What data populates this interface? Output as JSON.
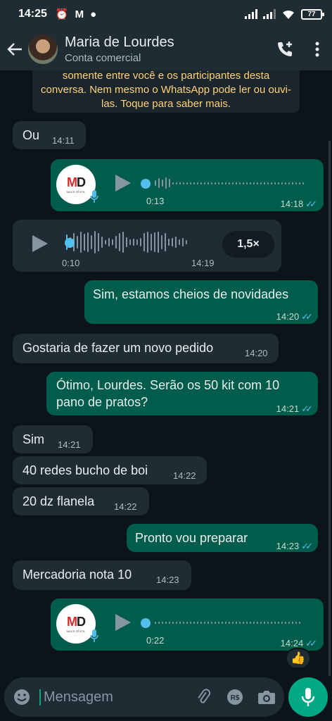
{
  "status_bar": {
    "time": "14:25",
    "battery": "77"
  },
  "header": {
    "contact_name": "Maria de Lourdes",
    "contact_subtitle": "Conta comercial"
  },
  "encryption_notice": "somente entre você e os participantes desta conversa. Nem mesmo o WhatsApp pode ler ou ouvi-las. Toque para saber mais.",
  "messages": [
    {
      "dir": "in",
      "text": "Ou",
      "time": "14:11"
    },
    {
      "dir": "out",
      "type": "audio",
      "duration": "0:13",
      "time": "14:18",
      "logo": "MD",
      "logo_sub": "MULTI TÊXTIL"
    },
    {
      "dir": "in",
      "type": "audio",
      "duration": "0:10",
      "time": "14:19",
      "speed": "1,5×"
    },
    {
      "dir": "out",
      "text": "Sim, estamos cheios de novidades",
      "time": "14:20"
    },
    {
      "dir": "in",
      "text": "Gostaria de fazer um novo pedido",
      "time": "14:20"
    },
    {
      "dir": "out",
      "text_line1": "Ótimo, Lourdes. Serão os 50 kit com 10",
      "text_line2": "pano de pratos?",
      "time": "14:21"
    },
    {
      "dir": "in",
      "text": "Sim",
      "time": "14:21"
    },
    {
      "dir": "in",
      "text": "40 redes bucho de boi",
      "time": "14:22"
    },
    {
      "dir": "in",
      "text": "20 dz flanela",
      "time": "14:22"
    },
    {
      "dir": "out",
      "text": "Pronto vou preparar",
      "time": "14:23"
    },
    {
      "dir": "in",
      "text": "Mercadoria nota 10",
      "time": "14:23"
    },
    {
      "dir": "out",
      "type": "audio",
      "duration": "0:22",
      "time": "14:24",
      "logo": "MD",
      "logo_sub": "MULTI TÊXTIL",
      "reaction": "👍"
    }
  ],
  "composer": {
    "placeholder": "Mensagem"
  },
  "colors": {
    "incoming": "#1f2c34",
    "outgoing": "#005c4b",
    "accent": "#00a884",
    "ticks": "#53bdeb"
  }
}
